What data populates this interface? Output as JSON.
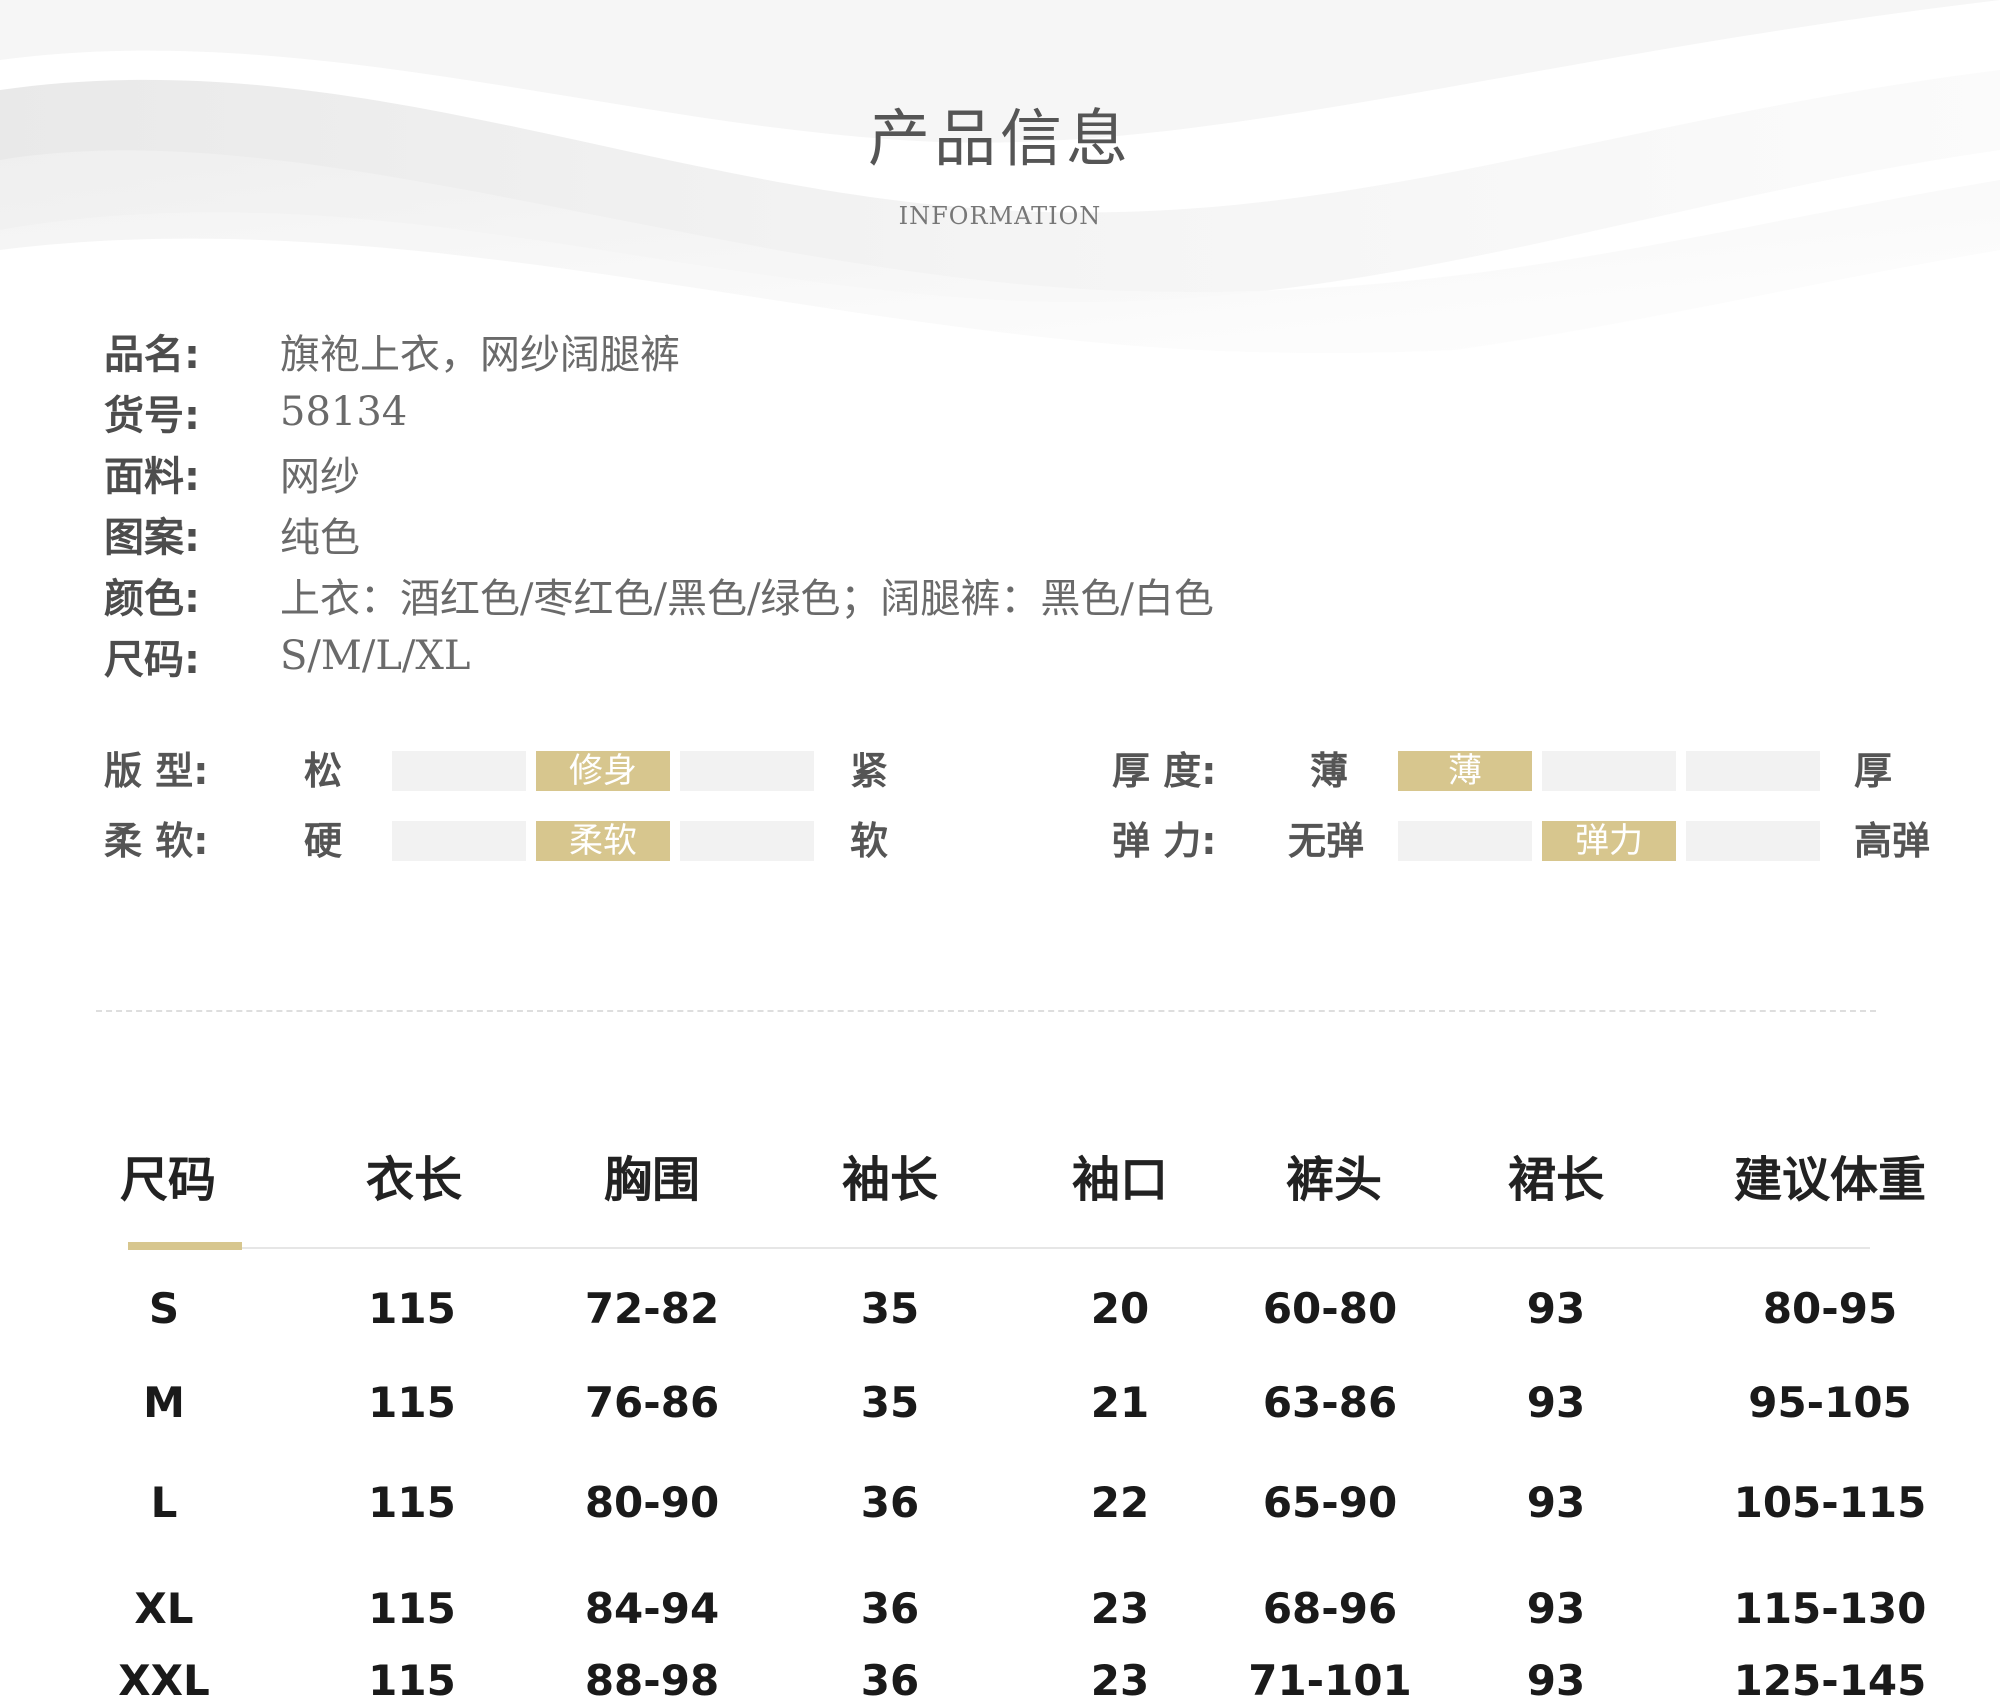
{
  "header": {
    "title": "产品信息",
    "subtitle": "INFORMATION"
  },
  "info": [
    {
      "label": "品名:",
      "value": "旗袍上衣，网纱阔腿裤"
    },
    {
      "label": "货号:",
      "value": "58134"
    },
    {
      "label": "面料:",
      "value": "网纱"
    },
    {
      "label": "图案:",
      "value": "纯色"
    },
    {
      "label": "颜色:",
      "value": "上衣：酒红色/枣红色/黑色/绿色；阔腿裤：黑色/白色"
    },
    {
      "label": "尺码:",
      "value": "S/M/L/XL"
    }
  ],
  "attributes": {
    "fit": {
      "label": "版 型:",
      "min": "松",
      "max": "紧",
      "selected_label": "修身",
      "level": 2,
      "steps": 3
    },
    "softness": {
      "label": "柔 软:",
      "min": "硬",
      "max": "软",
      "selected_label": "柔软",
      "level": 2,
      "steps": 3
    },
    "thickness": {
      "label": "厚 度:",
      "min": "薄",
      "max": "厚",
      "selected_label": "薄",
      "level": 1,
      "steps": 3
    },
    "elasticity": {
      "label": "弹 力:",
      "min": "无弹",
      "max": "高弹",
      "selected_label": "弹力",
      "level": 2,
      "steps": 3
    }
  },
  "size_table": {
    "headers": [
      "尺码",
      "衣长",
      "胸围",
      "袖长",
      "袖口",
      "裤头",
      "裙长",
      "建议体重"
    ],
    "rows": [
      [
        "S",
        "115",
        "72-82",
        "35",
        "20",
        "60-80",
        "93",
        "80-95"
      ],
      [
        "M",
        "115",
        "76-86",
        "35",
        "21",
        "63-86",
        "93",
        "95-105"
      ],
      [
        "L",
        "115",
        "80-90",
        "36",
        "22",
        "65-90",
        "93",
        "105-115"
      ],
      [
        "XL",
        "115",
        "84-94",
        "36",
        "23",
        "68-96",
        "93",
        "115-130"
      ],
      [
        "XXL",
        "115",
        "88-98",
        "36",
        "23",
        "71-101",
        "93",
        "125-145"
      ]
    ]
  },
  "colors": {
    "accent": "#d7c68e",
    "track": "#f2f2f2"
  }
}
